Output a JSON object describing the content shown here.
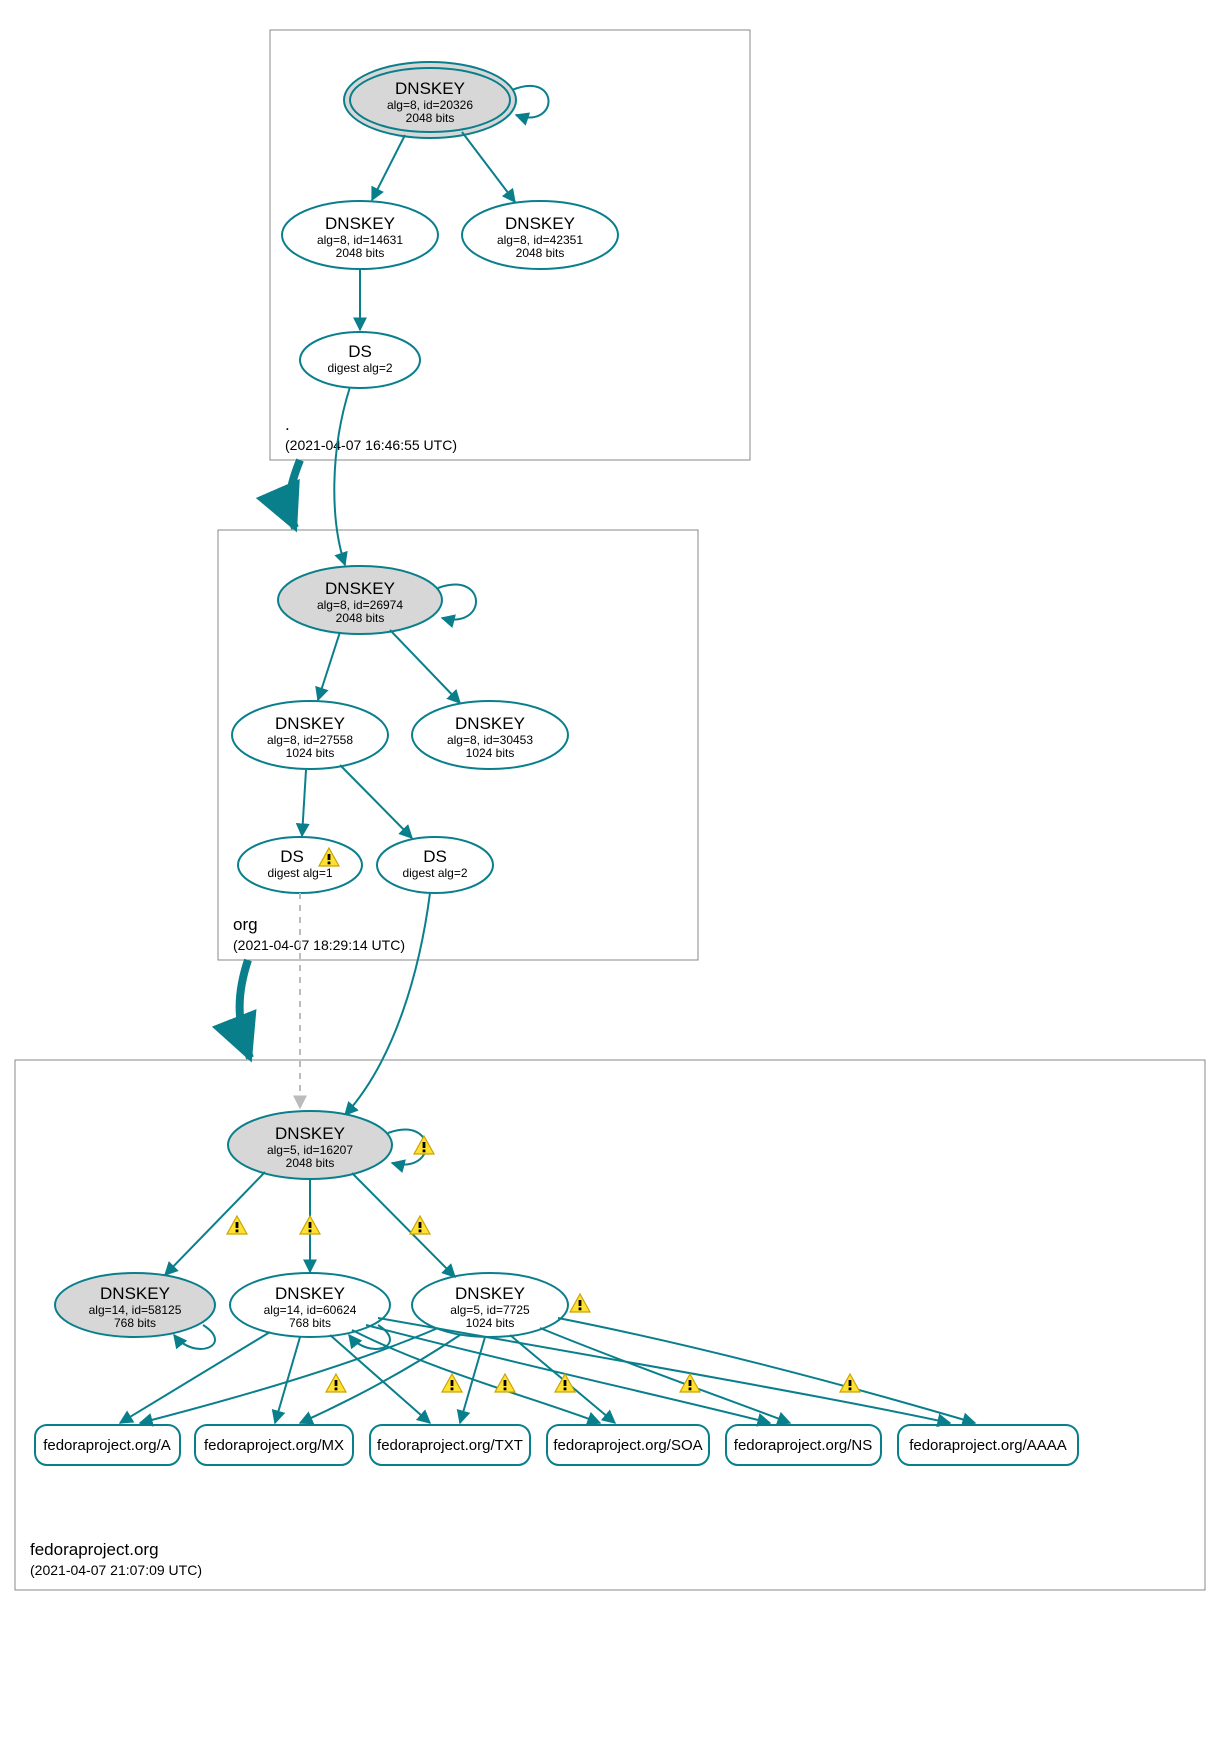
{
  "colors": {
    "stroke": "#0a7f8c",
    "fill_grey": "#d7d7d7",
    "zone_border": "#888888"
  },
  "zones": {
    "root": {
      "label": ".",
      "ts": "2021-04-07 16:46:55 UTC"
    },
    "org": {
      "label": "org",
      "ts": "2021-04-07 18:29:14 UTC"
    },
    "fedora": {
      "label": "fedoraproject.org",
      "ts": "2021-04-07 21:07:09 UTC"
    }
  },
  "nodes": {
    "root_ksk": {
      "title": "DNSKEY",
      "line2": "alg=8, id=20326",
      "line3": "2048 bits"
    },
    "root_zsk1": {
      "title": "DNSKEY",
      "line2": "alg=8, id=14631",
      "line3": "2048 bits"
    },
    "root_zsk2": {
      "title": "DNSKEY",
      "line2": "alg=8, id=42351",
      "line3": "2048 bits"
    },
    "root_ds": {
      "title": "DS",
      "line2": "digest alg=2",
      "line3": ""
    },
    "org_ksk": {
      "title": "DNSKEY",
      "line2": "alg=8, id=26974",
      "line3": "2048 bits"
    },
    "org_zsk1": {
      "title": "DNSKEY",
      "line2": "alg=8, id=27558",
      "line3": "1024 bits"
    },
    "org_zsk2": {
      "title": "DNSKEY",
      "line2": "alg=8, id=30453",
      "line3": "1024 bits"
    },
    "org_ds1": {
      "title": "DS",
      "line2": "digest alg=1",
      "line3": ""
    },
    "org_ds2": {
      "title": "DS",
      "line2": "digest alg=2",
      "line3": ""
    },
    "fed_ksk": {
      "title": "DNSKEY",
      "line2": "alg=5, id=16207",
      "line3": "2048 bits"
    },
    "fed_k14a": {
      "title": "DNSKEY",
      "line2": "alg=14, id=58125",
      "line3": "768 bits"
    },
    "fed_k14b": {
      "title": "DNSKEY",
      "line2": "alg=14, id=60624",
      "line3": "768 bits"
    },
    "fed_k5": {
      "title": "DNSKEY",
      "line2": "alg=5, id=7725",
      "line3": "1024 bits"
    },
    "rr_a": {
      "title": "fedoraproject.org/A"
    },
    "rr_mx": {
      "title": "fedoraproject.org/MX"
    },
    "rr_txt": {
      "title": "fedoraproject.org/TXT"
    },
    "rr_soa": {
      "title": "fedoraproject.org/SOA"
    },
    "rr_ns": {
      "title": "fedoraproject.org/NS"
    },
    "rr_aaaa": {
      "title": "fedoraproject.org/AAAA"
    }
  }
}
